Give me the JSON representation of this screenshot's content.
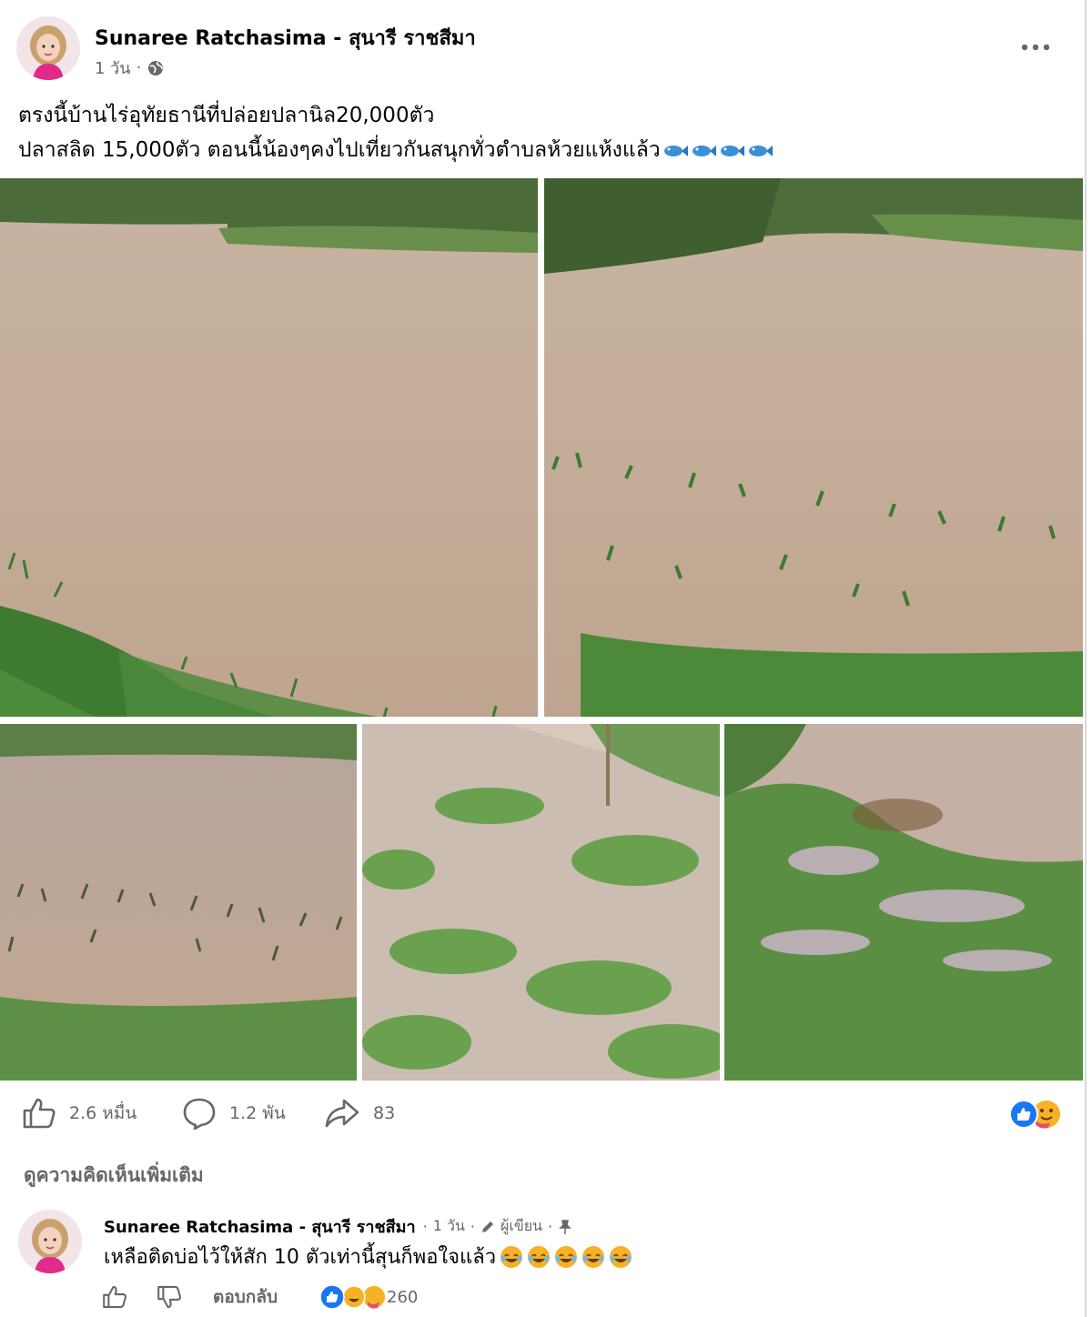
{
  "post": {
    "author": "Sunaree Ratchasima - สุนารี ราชสีมา",
    "time": "1 วัน",
    "privacy_icon": "globe-icon",
    "more_icon": "ellipsis-icon",
    "text_line1": "ตรงนี้บ้านไร่อุทัยธานีที่ปล่อยปลานิล20,000ตัว",
    "text_line2": "ปลาสลิด 15,000ตัว ตอนนี้น้องๆคงไปเที่ยวกันสนุกทั่วตำบลห้วยแห้งแล้ว",
    "text_emojis": [
      "fish-icon",
      "fish-icon",
      "fish-icon",
      "fish-icon"
    ],
    "photos": [
      "flooded-pond-photo-1",
      "flooded-pond-photo-2",
      "flooded-pond-photo-3",
      "flooded-grass-photo-4",
      "flooded-field-photo-5"
    ]
  },
  "actions": {
    "like_count": "2.6 หมื่น",
    "comment_count": "1.2 พัน",
    "share_count": "83",
    "reaction_icons": [
      "like-reaction-icon",
      "care-reaction-icon"
    ]
  },
  "more_comments_label": "ดูความคิดเห็นเพิ่มเติม",
  "comment": {
    "author": "Sunaree Ratchasima - สุนารี ราชสีมา",
    "time": "1 วัน",
    "badge": "ผู้เขียน",
    "text": "เหลือติดบ่อไว้ให้สัก 10 ตัวเท่านี้สุนก็พอใจแล้ว",
    "emojis": [
      "laughing-icon",
      "laughing-icon",
      "laughing-icon",
      "laughing-icon",
      "laughing-icon"
    ],
    "reply_label": "ตอบกลับ",
    "reaction_count": "260"
  },
  "colors": {
    "secondary_text": "#65676b",
    "primary_text": "#050505",
    "like_blue": "#1877f2",
    "divider": "#d8dadf"
  }
}
